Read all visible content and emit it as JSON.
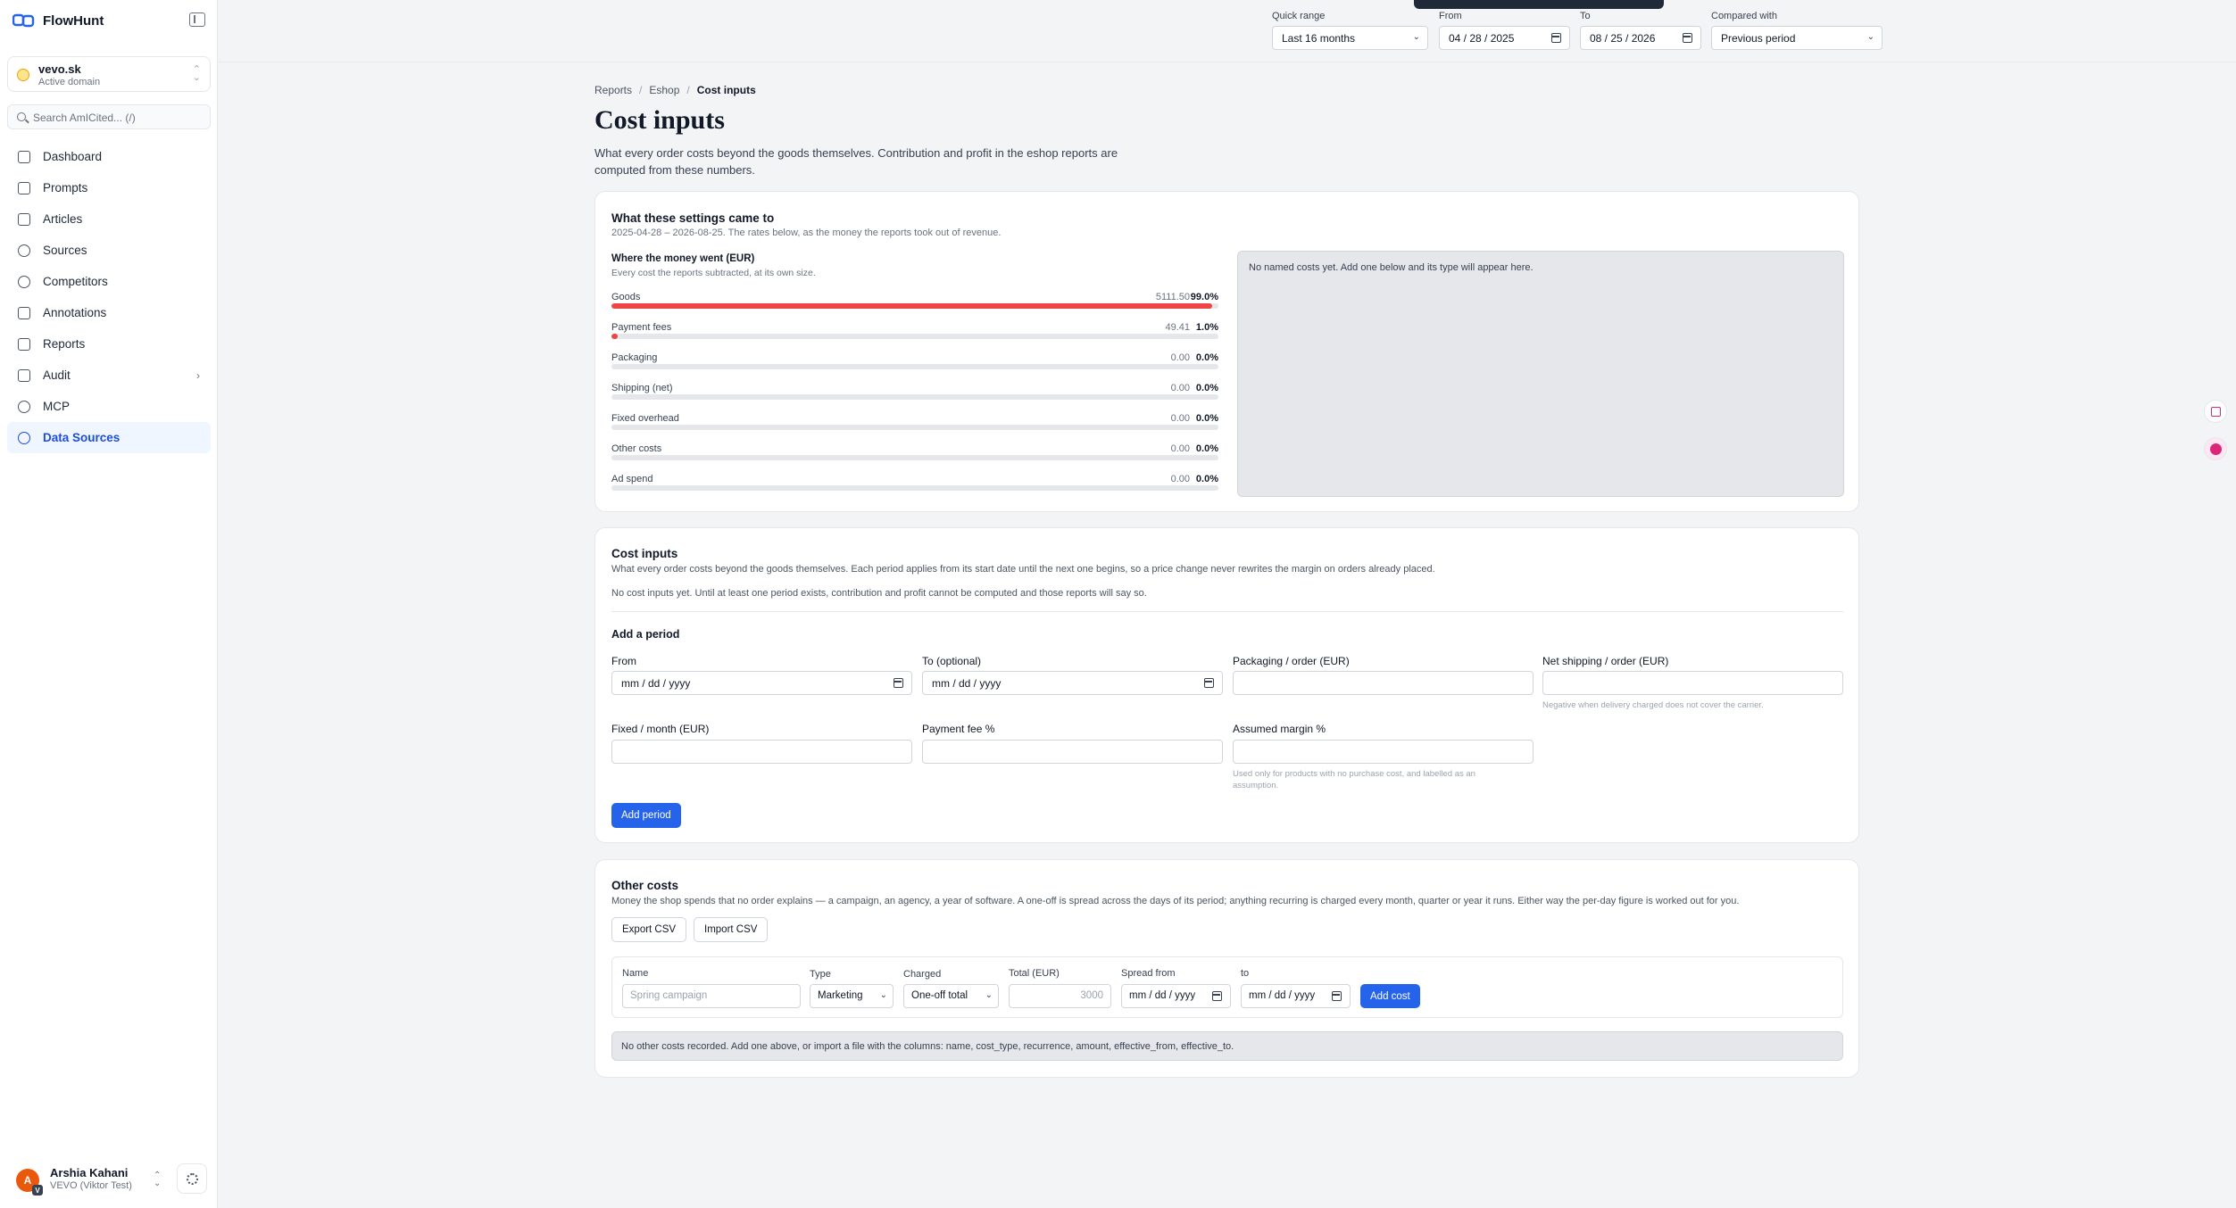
{
  "app": {
    "name": "FlowHunt",
    "brand_color": "#2563eb"
  },
  "domain": {
    "name": "vevo.sk",
    "status": "Active domain"
  },
  "search": {
    "placeholder": "Search AmICited... (/)"
  },
  "nav": {
    "items": [
      {
        "label": "Dashboard",
        "icon": "grid-icon"
      },
      {
        "label": "Prompts",
        "icon": "message-icon"
      },
      {
        "label": "Articles",
        "icon": "document-icon"
      },
      {
        "label": "Sources",
        "icon": "radar-icon"
      },
      {
        "label": "Competitors",
        "icon": "target-icon"
      },
      {
        "label": "Annotations",
        "icon": "note-icon"
      },
      {
        "label": "Reports",
        "icon": "report-icon"
      },
      {
        "label": "Audit",
        "icon": "audit-icon",
        "has_children": true
      },
      {
        "label": "MCP",
        "icon": "plug-icon"
      },
      {
        "label": "Data Sources",
        "icon": "sparkle-icon",
        "active": true
      }
    ]
  },
  "user": {
    "name": "Arshia Kahani",
    "org": "VEVO (Viktor Test)",
    "avatar_initial": "A",
    "badge": "V"
  },
  "filters": {
    "quick_range_label": "Quick range",
    "quick_range_value": "Last 16 months",
    "from_label": "From",
    "from_value": "04 / 28 / 2025",
    "to_label": "To",
    "to_value": "08 / 25 / 2026",
    "compared_label": "Compared with",
    "compared_value": "Previous period"
  },
  "breadcrumb": [
    "Reports",
    "Eshop",
    "Cost inputs"
  ],
  "page": {
    "title": "Cost inputs",
    "description": "What every order costs beyond the goods themselves. Contribution and profit in the eshop reports are computed from these numbers."
  },
  "summary": {
    "title": "What these settings came to",
    "subtitle": "2025-04-28 – 2026-08-25. The rates below, as the money the reports took out of revenue.",
    "breakdown_title": "Where the money went (EUR)",
    "breakdown_subtitle": "Every cost the reports subtracted, at its own size.",
    "rows": [
      {
        "label": "Goods",
        "value": "5111.50",
        "pct": "99.0%",
        "fraction": 0.99
      },
      {
        "label": "Payment fees",
        "value": "49.41",
        "pct": "1.0%",
        "fraction": 0.01
      },
      {
        "label": "Packaging",
        "value": "0.00",
        "pct": "0.0%",
        "fraction": 0
      },
      {
        "label": "Shipping (net)",
        "value": "0.00",
        "pct": "0.0%",
        "fraction": 0
      },
      {
        "label": "Fixed overhead",
        "value": "0.00",
        "pct": "0.0%",
        "fraction": 0
      },
      {
        "label": "Other costs",
        "value": "0.00",
        "pct": "0.0%",
        "fraction": 0
      },
      {
        "label": "Ad spend",
        "value": "0.00",
        "pct": "0.0%",
        "fraction": 0
      }
    ],
    "named_empty": "No named costs yet. Add one below and its type will appear here.",
    "bar_color": "#ef4444"
  },
  "cost_inputs": {
    "title": "Cost inputs",
    "description": "What every order costs beyond the goods themselves. Each period applies from its start date until the next one begins, so a price change never rewrites the margin on orders already placed.",
    "empty_note": "No cost inputs yet. Until at least one period exists, contribution and profit cannot be computed and those reports will say so.",
    "add_title": "Add a period",
    "fields": {
      "from_label": "From",
      "from_placeholder": "mm / dd / yyyy",
      "to_label": "To (optional)",
      "to_placeholder": "mm / dd / yyyy",
      "packaging_label": "Packaging / order (EUR)",
      "shipping_label": "Net shipping / order (EUR)",
      "shipping_help": "Negative when delivery charged does not cover the carrier.",
      "fixed_label": "Fixed / month (EUR)",
      "payment_fee_label": "Payment fee %",
      "margin_label": "Assumed margin %",
      "margin_help": "Used only for products with no purchase cost, and labelled as an assumption."
    },
    "add_button": "Add period"
  },
  "other_costs": {
    "title": "Other costs",
    "description": "Money the shop spends that no order explains — a campaign, an agency, a year of software. A one-off is spread across the days of its period; anything recurring is charged every month, quarter or year it runs. Either way the per-day figure is worked out for you.",
    "export_button": "Export CSV",
    "import_button": "Import CSV",
    "form": {
      "name_label": "Name",
      "name_placeholder": "Spring campaign",
      "type_label": "Type",
      "type_value": "Marketing",
      "charged_label": "Charged",
      "charged_value": "One-off total",
      "total_label": "Total (EUR)",
      "total_placeholder": "3000",
      "spread_from_label": "Spread from",
      "spread_from_placeholder": "mm / dd / yyyy",
      "to_label": "to",
      "to_placeholder": "mm / dd / yyyy",
      "add_button": "Add cost"
    },
    "empty_note": "No other costs recorded. Add one above, or import a file with the columns: name, cost_type, recurrence, amount, effective_from, effective_to."
  }
}
